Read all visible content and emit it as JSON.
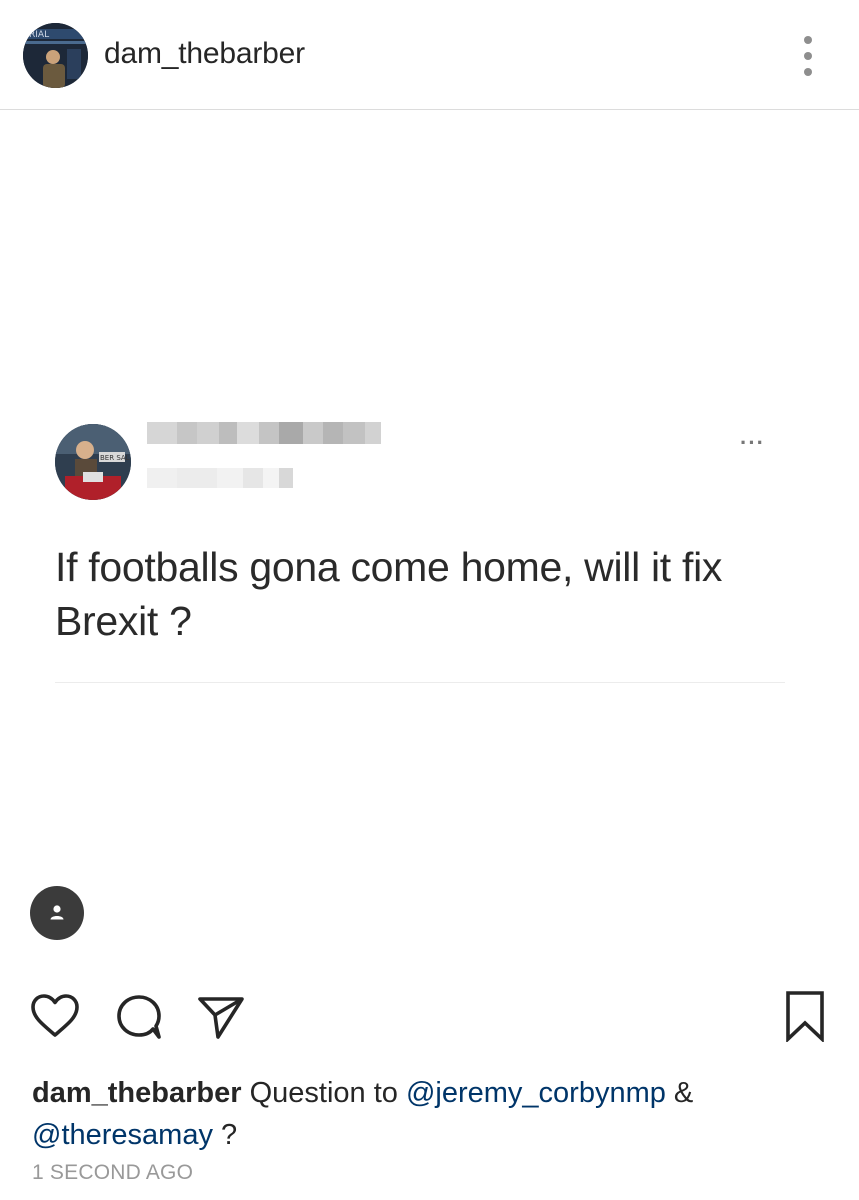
{
  "header": {
    "username": "dam_thebarber",
    "avatar_icon": "profile-photo-icon",
    "more_icon": "more-vertical-icon"
  },
  "post": {
    "tweet": {
      "text": "If footballs gona come home, will it fix Brexit ?",
      "more_icon": "more-horizontal-icon",
      "author_name": "",
      "author_handle": ""
    },
    "tag_icon": "user-tag-icon"
  },
  "actions": {
    "like_icon": "heart-icon",
    "comment_icon": "comment-icon",
    "share_icon": "send-icon",
    "save_icon": "bookmark-icon"
  },
  "caption": {
    "username": "dam_thebarber",
    "text_before": " Question to ",
    "mention_1": "@jeremy_corbynmp",
    "text_between": " & ",
    "mention_2": "@theresamay",
    "text_after": " ?"
  },
  "timestamp": "1 SECOND AGO",
  "colors": {
    "mention": "#003569",
    "text": "#262626",
    "muted": "#999999"
  }
}
